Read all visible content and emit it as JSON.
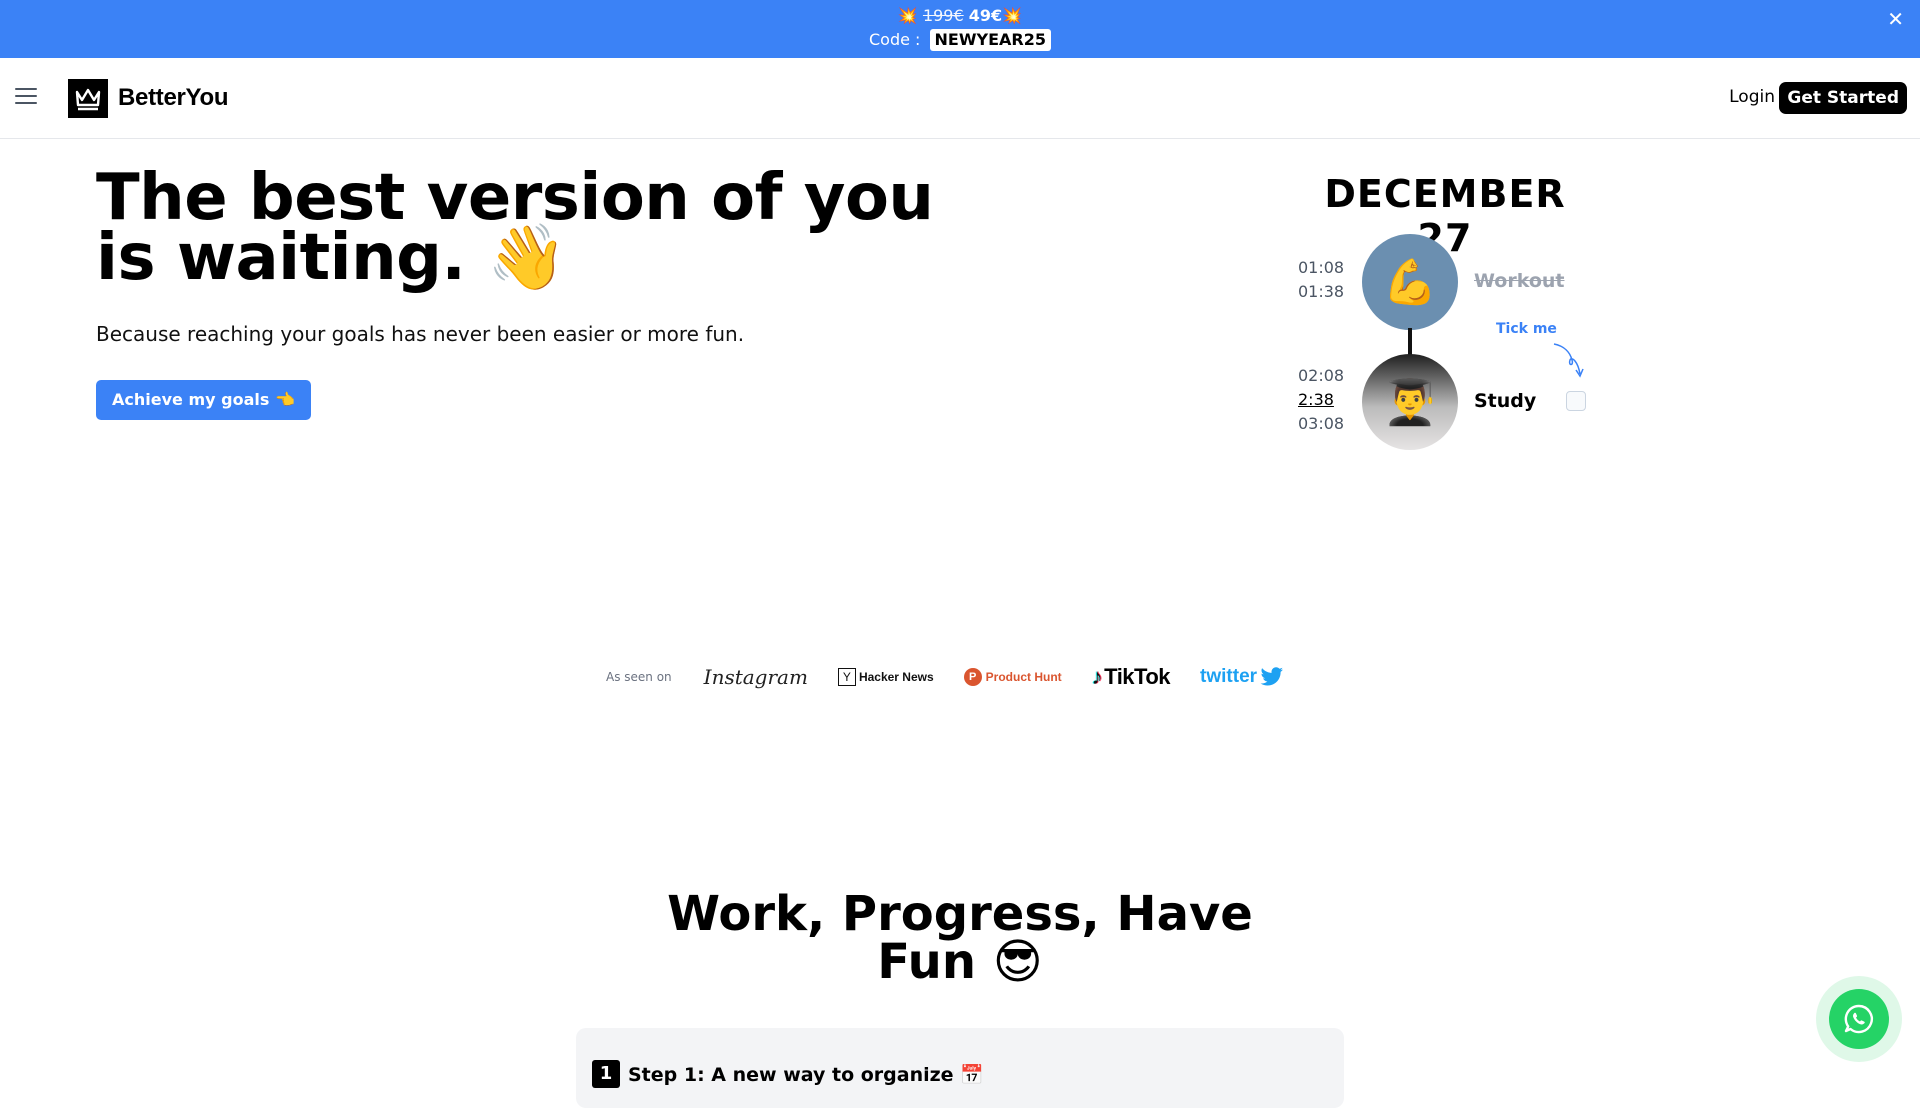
{
  "promo": {
    "emoji": "💥",
    "old_price": "199€",
    "new_price": "49€",
    "code_label": "Code :",
    "code": "NEWYEAR25",
    "close": "✕"
  },
  "nav": {
    "brand": "BetterYou",
    "login": "Login",
    "get_started": "Get Started"
  },
  "hero": {
    "title": "The best version of you is waiting. 👋",
    "subtitle": "Because reaching your goals has never been easier or more fun.",
    "cta": "Achieve my goals 👈"
  },
  "timeline": {
    "date": "DECEMBER 27",
    "tasks": [
      {
        "name": "Workout",
        "emoji": "💪",
        "times": [
          "01:08",
          "01:38"
        ],
        "done": true
      },
      {
        "name": "Study",
        "emoji": "👨‍🎓",
        "times": [
          "02:08",
          "2:38",
          "03:08"
        ],
        "current_time": "2:38",
        "done": false
      }
    ],
    "hint": "Tick me"
  },
  "seen_on": {
    "label": "As seen on",
    "brands": [
      "Instagram",
      "Hacker News",
      "Product Hunt",
      "TikTok",
      "twitter"
    ]
  },
  "section": {
    "title": "Work, Progress, Have Fun 😎",
    "step_number": "1",
    "step_title": "Step 1: A new way to organize 📅"
  },
  "colors": {
    "accent": "#3b82f6",
    "whatsapp": "#25d366"
  }
}
